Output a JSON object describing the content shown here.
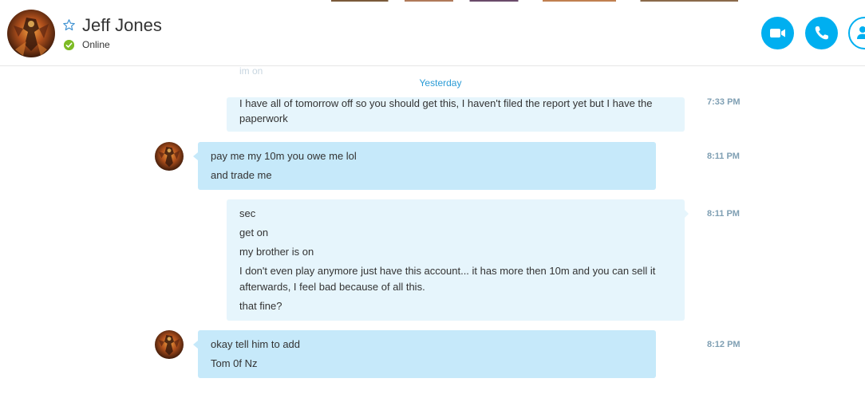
{
  "colors": {
    "accent": "#00aff0",
    "online": "#7dbb25",
    "incoming_bubble": "#c6e9fa",
    "outgoing_bubble": "#e6f5fc",
    "day_label": "#2a9bd6"
  },
  "header": {
    "contact_name": "Jeff Jones",
    "status": "Online",
    "avatar": "contact-avatar",
    "favorite_icon": "star-outline-icon",
    "actions": [
      {
        "name": "video-call",
        "icon": "video-camera-icon"
      },
      {
        "name": "audio-call",
        "icon": "phone-icon"
      },
      {
        "name": "add-people",
        "icon": "add-person-icon"
      }
    ]
  },
  "chat": {
    "ghost": {
      "text": "im on",
      "time": ""
    },
    "day_label": "Yesterday",
    "messages": [
      {
        "direction": "outgoing",
        "time": "7:33 PM",
        "lines": [
          "I have all of tomorrow off so you should get this, I haven't filed the report yet but I have the",
          "paperwork"
        ]
      },
      {
        "direction": "incoming",
        "time": "8:11 PM",
        "lines": [
          "pay me my 10m you owe me lol",
          "and trade me"
        ]
      },
      {
        "direction": "outgoing",
        "time": "8:11 PM",
        "lines": [
          "sec",
          "get on",
          "my brother is on",
          "I don't even play anymore just have this account... it has more then 10m and you can sell it",
          "afterwards, I feel bad because of all this.",
          "that fine?"
        ]
      },
      {
        "direction": "incoming",
        "time": "8:12 PM",
        "lines": [
          "okay tell him to add",
          "Tom 0f Nz"
        ]
      }
    ]
  }
}
